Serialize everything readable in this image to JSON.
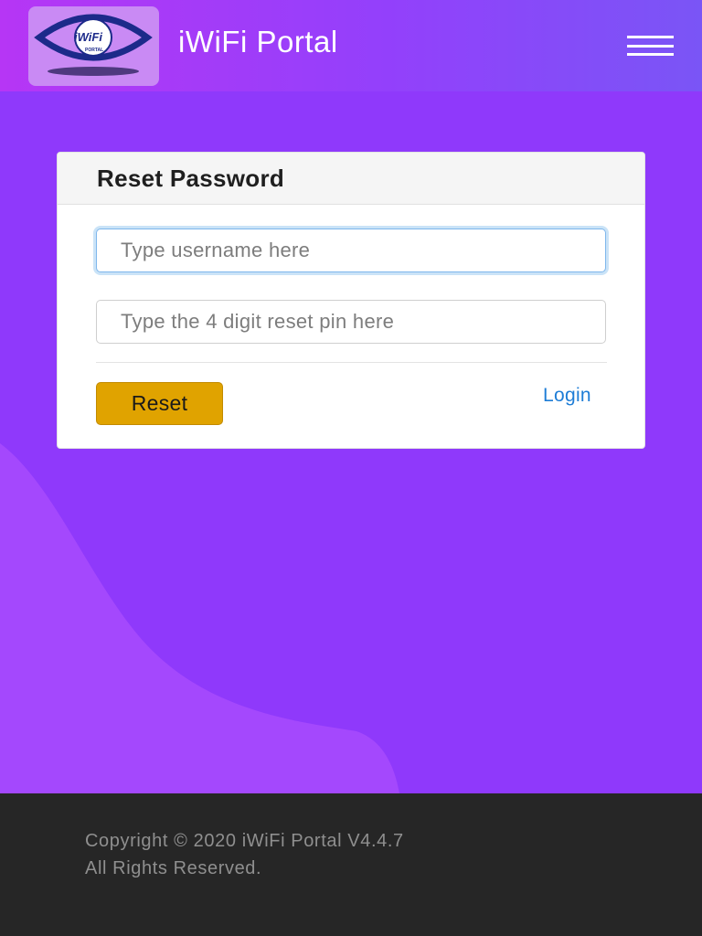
{
  "header": {
    "logo_text": "iWiFi",
    "logo_subtext": "PORTAL",
    "title": "iWiFi Portal",
    "menu_icon": "hamburger-menu-icon"
  },
  "form": {
    "title": "Reset Password",
    "username_placeholder": "Type username here",
    "username_value": "",
    "pin_placeholder": "Type the 4 digit reset pin here",
    "pin_value": "",
    "reset_label": "Reset",
    "login_label": "Login"
  },
  "footer": {
    "line1": "Copyright © 2020 iWiFi Portal V4.4.7",
    "line2": "All Rights Reserved."
  },
  "colors": {
    "header_gradient_start": "#b636f5",
    "header_gradient_end": "#7a55f6",
    "background": "#8f39fb",
    "wave": "#a448fd",
    "reset_button": "#e0a300",
    "link": "#1e7dd6",
    "footer": "#262626"
  }
}
